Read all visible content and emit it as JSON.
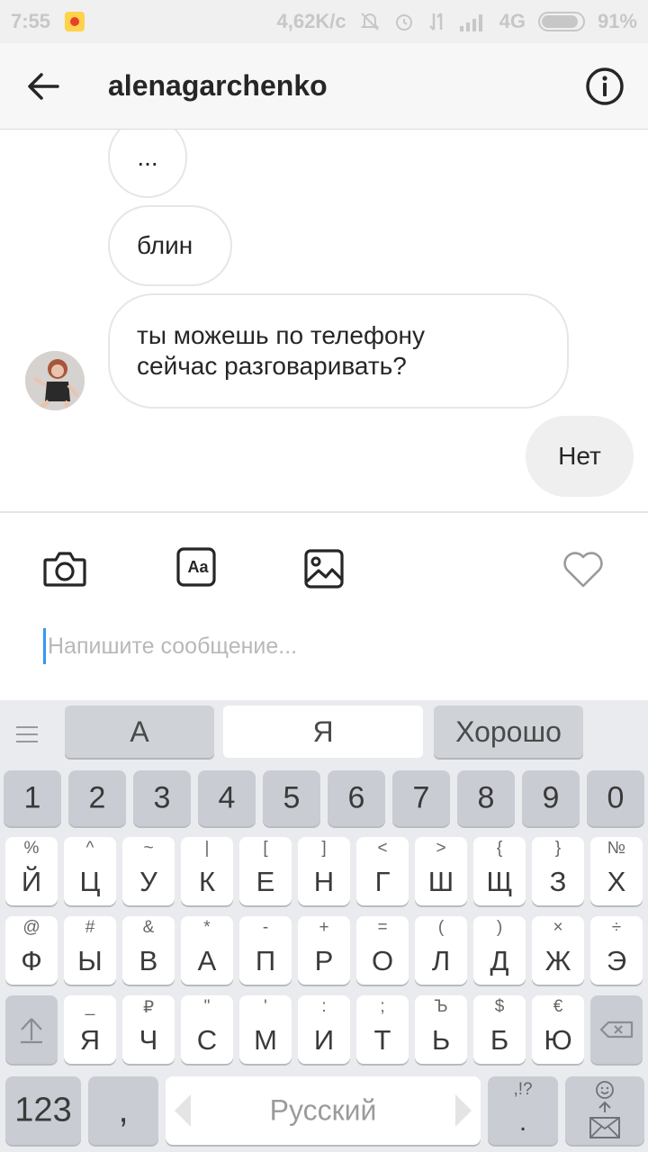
{
  "status_bar": {
    "time": "7:55",
    "network_speed": "4,62K/c",
    "network_type": "4G",
    "battery": "91%",
    "icons": [
      "notification-app-icon",
      "mute-icon",
      "alarm-icon",
      "data-transfer-icon",
      "signal-icon",
      "battery-icon"
    ]
  },
  "header": {
    "title": "alenagarchenko",
    "back_icon": "arrow-left-icon",
    "info_icon": "info-circle-icon"
  },
  "messages": [
    {
      "from": "other",
      "text": "..."
    },
    {
      "from": "other",
      "text": "блин"
    },
    {
      "from": "other",
      "lines": [
        "ты можешь по телефону",
        "сейчас разговаривать?"
      ]
    },
    {
      "from": "me",
      "text": "Нет"
    }
  ],
  "composer": {
    "tools": [
      "camera-icon",
      "text-format-icon",
      "gallery-icon",
      "heart-icon"
    ],
    "text_format_label": "Aa",
    "placeholder": "Напишите сообщение..."
  },
  "keyboard": {
    "suggestions": [
      "А",
      "Я",
      "Хорошо"
    ],
    "numbers": [
      "1",
      "2",
      "3",
      "4",
      "5",
      "6",
      "7",
      "8",
      "9",
      "0"
    ],
    "row1": [
      {
        "k": "Й",
        "h": "%"
      },
      {
        "k": "Ц",
        "h": "^"
      },
      {
        "k": "У",
        "h": "~"
      },
      {
        "k": "К",
        "h": "|"
      },
      {
        "k": "Е",
        "h": "["
      },
      {
        "k": "Н",
        "h": "]"
      },
      {
        "k": "Г",
        "h": "<"
      },
      {
        "k": "Ш",
        "h": ">"
      },
      {
        "k": "Щ",
        "h": "{"
      },
      {
        "k": "З",
        "h": "}"
      },
      {
        "k": "Х",
        "h": "№"
      }
    ],
    "row2": [
      {
        "k": "Ф",
        "h": "@"
      },
      {
        "k": "Ы",
        "h": "#"
      },
      {
        "k": "В",
        "h": "&"
      },
      {
        "k": "А",
        "h": "*"
      },
      {
        "k": "П",
        "h": "-"
      },
      {
        "k": "Р",
        "h": "+"
      },
      {
        "k": "О",
        "h": "="
      },
      {
        "k": "Л",
        "h": "("
      },
      {
        "k": "Д",
        "h": ")"
      },
      {
        "k": "Ж",
        "h": "×"
      },
      {
        "k": "Э",
        "h": "÷"
      }
    ],
    "row3": [
      {
        "k": "Я",
        "h": "_"
      },
      {
        "k": "Ч",
        "h": "₽"
      },
      {
        "k": "С",
        "h": "\""
      },
      {
        "k": "М",
        "h": "'"
      },
      {
        "k": "И",
        "h": ":"
      },
      {
        "k": "Т",
        "h": ";"
      },
      {
        "k": "Ь",
        "h": "Ъ"
      },
      {
        "k": "Б",
        "h": "$"
      },
      {
        "k": "Ю",
        "h": "€"
      }
    ],
    "mode_key": "123",
    "comma_key": ",",
    "space_label": "Русский",
    "punct_hint": ",!?",
    "punct_key": ".",
    "shift_icon": "shift-arrow-icon",
    "backspace_icon": "backspace-icon",
    "enter_icons": [
      "smiley-icon",
      "send-envelope-icon"
    ]
  }
}
